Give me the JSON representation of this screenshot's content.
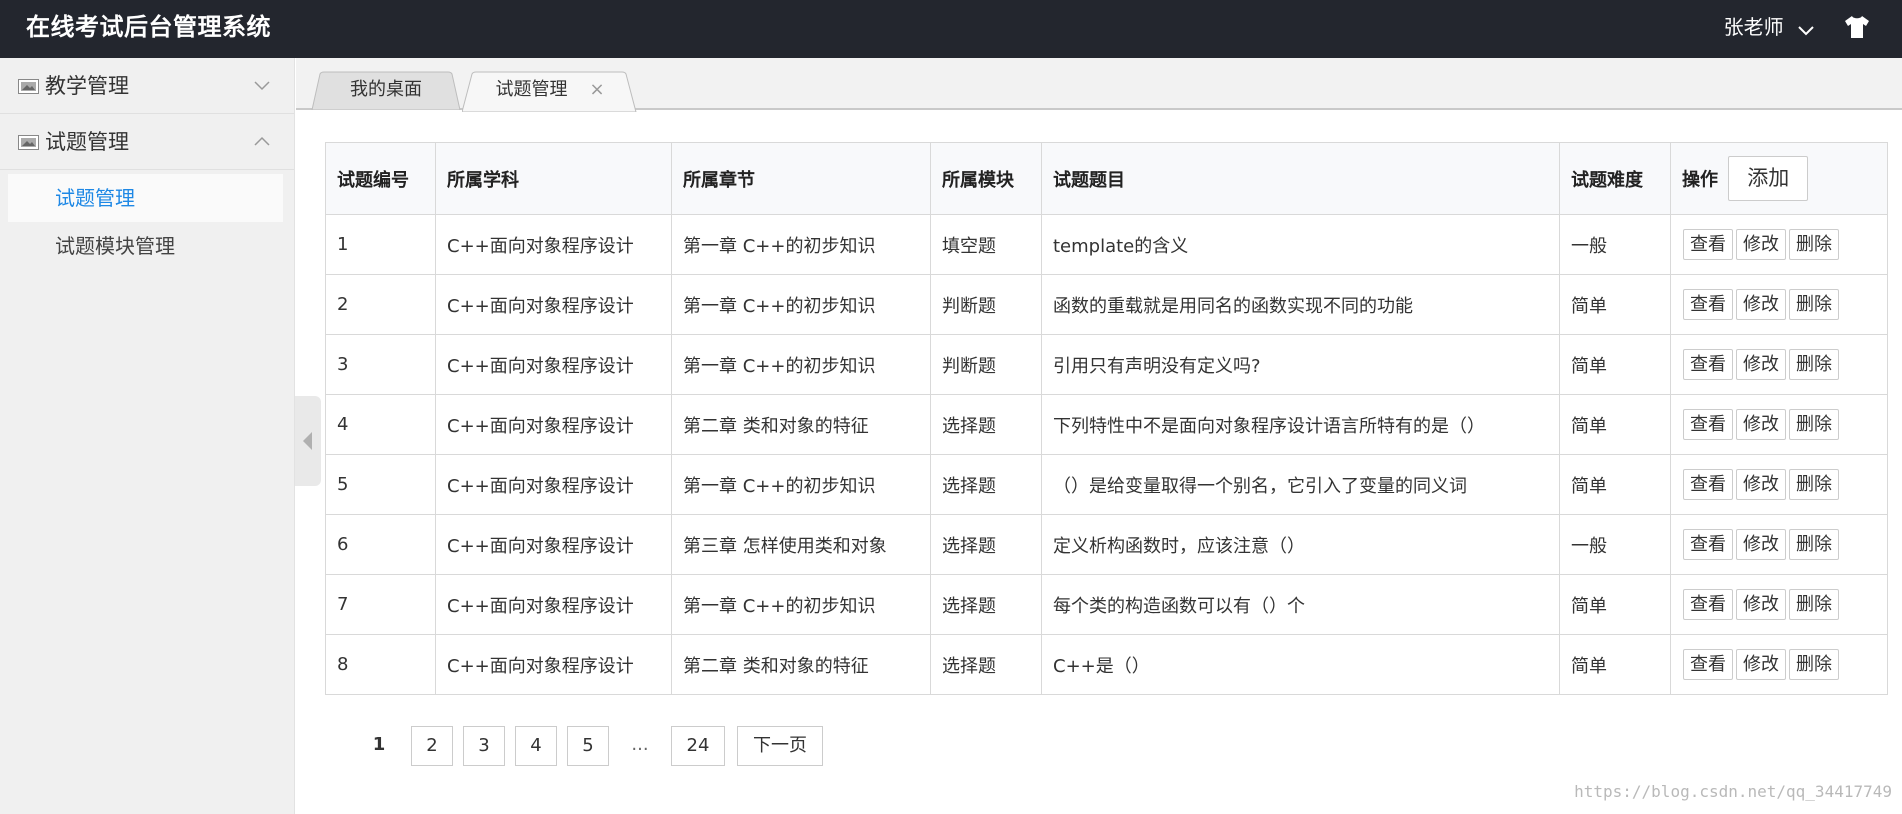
{
  "header": {
    "app_title": "在线考试后台管理系统",
    "user_name": "张老师"
  },
  "sidebar": {
    "groups": [
      {
        "label": "教学管理",
        "expanded": false
      },
      {
        "label": "试题管理",
        "expanded": true
      }
    ],
    "sub_items": [
      {
        "label": "试题管理",
        "active": true
      },
      {
        "label": "试题模块管理",
        "active": false
      }
    ],
    "accent_color": "#1e88e5"
  },
  "tabs": [
    {
      "label": "我的桌面"
    },
    {
      "label": "试题管理",
      "close": "×"
    }
  ],
  "table": {
    "headers": [
      "试题编号",
      "所属学科",
      "所属章节",
      "所属模块",
      "试题题目",
      "试题难度",
      "操作"
    ],
    "add_label": "添加",
    "action_labels": {
      "view": "查看",
      "edit": "修改",
      "delete": "删除"
    },
    "rows": [
      [
        "1",
        "C++面向对象程序设计",
        "第一章 C++的初步知识",
        "填空题",
        "template的含义",
        "一般"
      ],
      [
        "2",
        "C++面向对象程序设计",
        "第一章 C++的初步知识",
        "判断题",
        "函数的重载就是用同名的函数实现不同的功能",
        "简单"
      ],
      [
        "3",
        "C++面向对象程序设计",
        "第一章 C++的初步知识",
        "判断题",
        "引用只有声明没有定义吗?",
        "简单"
      ],
      [
        "4",
        "C++面向对象程序设计",
        "第二章 类和对象的特征",
        "选择题",
        "下列特性中不是面向对象程序设计语言所特有的是（）",
        "简单"
      ],
      [
        "5",
        "C++面向对象程序设计",
        "第一章 C++的初步知识",
        "选择题",
        "（）是给变量取得一个别名，它引入了变量的同义词",
        "简单"
      ],
      [
        "6",
        "C++面向对象程序设计",
        "第三章 怎样使用类和对象",
        "选择题",
        "定义析构函数时，应该注意（）",
        "一般"
      ],
      [
        "7",
        "C++面向对象程序设计",
        "第一章 C++的初步知识",
        "选择题",
        "每个类的构造函数可以有（）个",
        "简单"
      ],
      [
        "8",
        "C++面向对象程序设计",
        "第二章 类和对象的特征",
        "选择题",
        "C++是（）",
        "简单"
      ]
    ]
  },
  "pagination": {
    "current": "1",
    "pages": [
      "2",
      "3",
      "4",
      "5"
    ],
    "ellipsis": "...",
    "last": "24",
    "next": "下一页"
  },
  "watermark": "https://blog.csdn.net/qq_34417749"
}
